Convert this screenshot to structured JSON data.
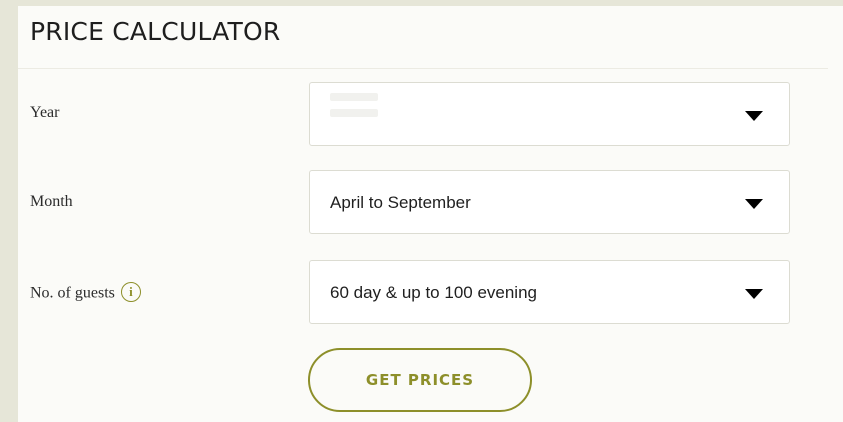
{
  "calculator": {
    "title": "PRICE CALCULATOR",
    "fields": [
      {
        "label": "Year",
        "value": ""
      },
      {
        "label": "Month",
        "value": "April to September"
      },
      {
        "label": "No. of guests",
        "value": "60 day & up to 100 evening",
        "info_icon": "info-icon"
      }
    ],
    "button_label": "GET PRICES"
  },
  "colors": {
    "accent": "#8d8f2a",
    "page_background": "#e6e6d8",
    "panel_background": "#fbfbf8"
  }
}
